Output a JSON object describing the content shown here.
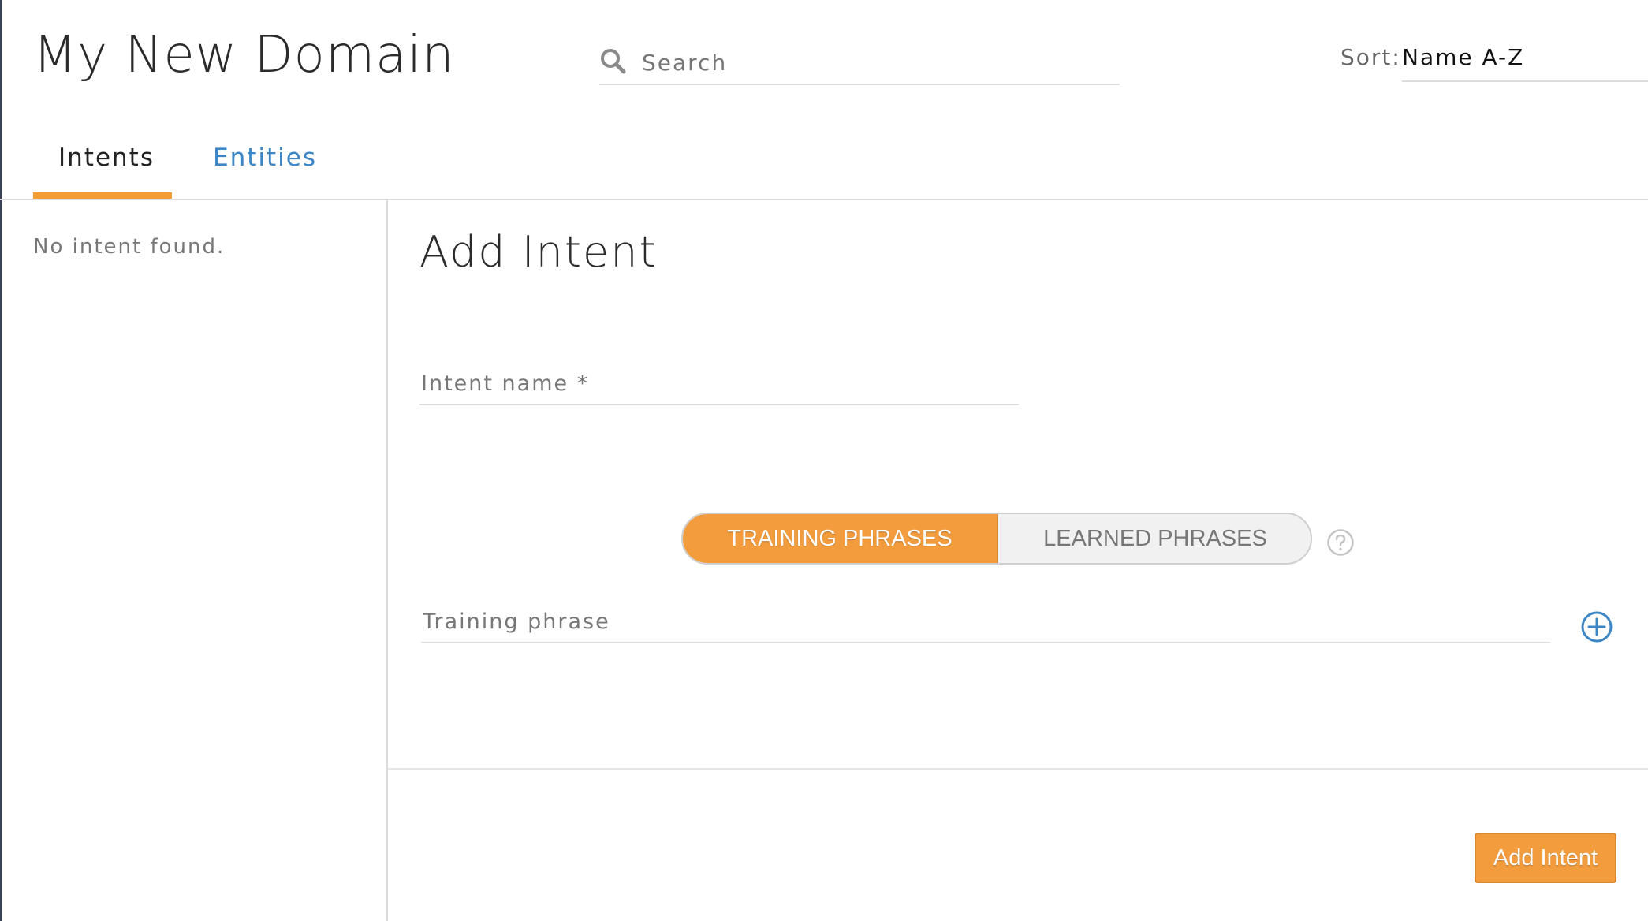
{
  "header": {
    "title": "My New Domain",
    "search_placeholder": "Search",
    "sort_label": "Sort:",
    "sort_value": "Name A-Z"
  },
  "tabs": [
    {
      "label": "Intents",
      "active": true
    },
    {
      "label": "Entities",
      "active": false
    }
  ],
  "sidebar": {
    "empty_text": "No intent found."
  },
  "form": {
    "heading": "Add Intent",
    "intent_name_placeholder": "Intent name *",
    "toggle": {
      "active_label": "TRAINING PHRASES",
      "inactive_label": "LEARNED PHRASES"
    },
    "training_phrase_placeholder": "Training phrase",
    "submit_label": "Add Intent"
  },
  "icons": {
    "search": "search-icon",
    "help": "question-circle-icon",
    "add": "plus-circle-icon"
  },
  "colors": {
    "accent": "#f39c3d",
    "link": "#3d86c6"
  }
}
